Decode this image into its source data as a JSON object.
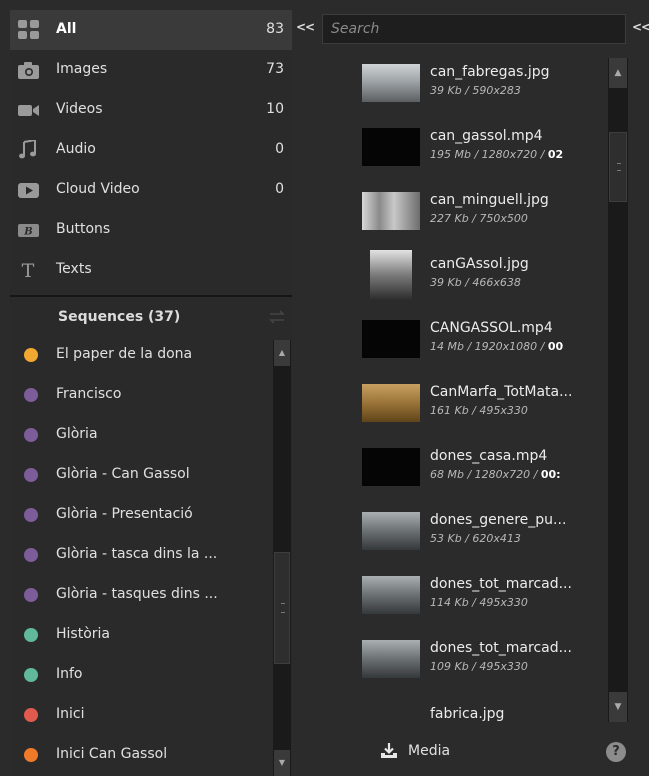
{
  "categories": [
    {
      "label": "All",
      "count": "83",
      "icon": "grid-icon"
    },
    {
      "label": "Images",
      "count": "73",
      "icon": "camera-icon"
    },
    {
      "label": "Videos",
      "count": "10",
      "icon": "video-camera-icon"
    },
    {
      "label": "Audio",
      "count": "0",
      "icon": "music-note-icon"
    },
    {
      "label": "Cloud Video",
      "count": "0",
      "icon": "play-icon"
    },
    {
      "label": "Buttons",
      "count": "",
      "icon": "button-icon"
    },
    {
      "label": "Texts",
      "count": "",
      "icon": "text-icon"
    }
  ],
  "sequences": {
    "title": "Sequences (37)",
    "items": [
      {
        "label": "El paper de la dona",
        "color": "#f0a830"
      },
      {
        "label": "Francisco",
        "color": "#7d5c9a"
      },
      {
        "label": "Glòria",
        "color": "#7d5c9a"
      },
      {
        "label": "Glòria - Can Gassol",
        "color": "#7d5c9a"
      },
      {
        "label": "Glòria - Presentació",
        "color": "#7d5c9a"
      },
      {
        "label": "Glòria - tasca dins la ...",
        "color": "#7d5c9a"
      },
      {
        "label": "Glòria - tasques dins ...",
        "color": "#7d5c9a"
      },
      {
        "label": "Història",
        "color": "#5fb99a"
      },
      {
        "label": "Info",
        "color": "#5fb99a"
      },
      {
        "label": "Inici",
        "color": "#e05a4e"
      },
      {
        "label": "Inici Can Gassol",
        "color": "#ef7a2a"
      }
    ]
  },
  "search": {
    "placeholder": "Search",
    "collapse_left": "<<",
    "collapse_right": "<<"
  },
  "media": [
    {
      "name": "can_fabregas.jpg",
      "meta": "39 Kb / 590x283",
      "extra": "",
      "thumb": "photo"
    },
    {
      "name": "can_gassol.mp4",
      "meta": "195 Mb / 1280x720 / ",
      "extra": "02",
      "thumb": "black"
    },
    {
      "name": "can_minguell.jpg",
      "meta": "227 Kb / 750x500",
      "extra": "",
      "thumb": "photo2"
    },
    {
      "name": "canGAssol.jpg",
      "meta": "39 Kb / 466x638",
      "extra": "",
      "thumb": "portrait"
    },
    {
      "name": "CANGASSOL.mp4",
      "meta": "14 Mb / 1920x1080 / ",
      "extra": "00",
      "thumb": "black"
    },
    {
      "name": "CanMarfa_TotMata...",
      "meta": "161 Kb / 495x330",
      "extra": "",
      "thumb": "sepia"
    },
    {
      "name": "dones_casa.mp4",
      "meta": "68 Mb / 1280x720 / ",
      "extra": "00:",
      "thumb": "black"
    },
    {
      "name": "dones_genere_pu...",
      "meta": "53 Kb / 620x413",
      "extra": "",
      "thumb": "crowd"
    },
    {
      "name": "dones_tot_marcad...",
      "meta": "114 Kb / 495x330",
      "extra": "",
      "thumb": "crowd"
    },
    {
      "name": "dones_tot_marcad...",
      "meta": "109 Kb / 495x330",
      "extra": "",
      "thumb": "crowd"
    },
    {
      "name": "fabrica.jpg",
      "meta": "",
      "extra": "",
      "thumb": "strip"
    }
  ],
  "bottom": {
    "media_label": "Media",
    "help_label": "?"
  }
}
